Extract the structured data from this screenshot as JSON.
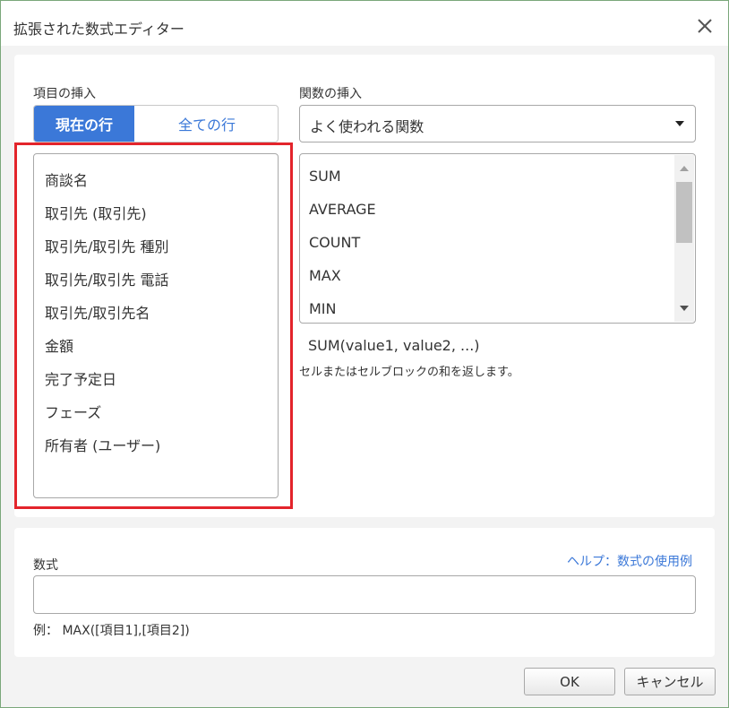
{
  "window": {
    "title": "拡張された数式エディター",
    "close_icon": "×"
  },
  "insert_field": {
    "label": "項目の挿入",
    "tabs": [
      {
        "label": "現在の行",
        "active": true
      },
      {
        "label": "全ての行",
        "active": false
      }
    ],
    "items": [
      "商談名",
      "取引先 (取引先)",
      "取引先/取引先 種別",
      "取引先/取引先 電話",
      "取引先/取引先名",
      "金額",
      "完了予定日",
      "フェーズ",
      "所有者 (ユーザー)"
    ],
    "highlight_color": "#e3242b"
  },
  "insert_function": {
    "label": "関数の挿入",
    "category_selected": "よく使われる関数",
    "functions": [
      "SUM",
      "AVERAGE",
      "COUNT",
      "MAX",
      "MIN"
    ],
    "signature": "SUM(value1, value2, ...)",
    "description": "セルまたはセルブロックの和を返します。"
  },
  "formula": {
    "label": "数式",
    "help_link": "ヘルプ：数式の使用例",
    "value": "",
    "example": "例： MAX([項目1],[項目2])"
  },
  "buttons": {
    "ok": "OK",
    "cancel": "キャンセル"
  },
  "colors": {
    "accent": "#3b78d8",
    "border_window": "#7aa77a"
  }
}
